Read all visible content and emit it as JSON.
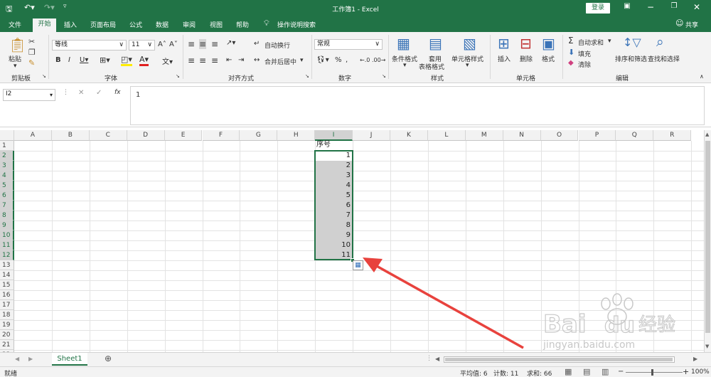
{
  "window": {
    "title": "工作簿1  -  Excel",
    "login": "登录",
    "share": "共享"
  },
  "tabs": [
    "文件",
    "开始",
    "插入",
    "页面布局",
    "公式",
    "数据",
    "审阅",
    "视图",
    "帮助",
    "操作说明搜索"
  ],
  "ribbon": {
    "clipboard": {
      "paste": "粘贴",
      "label": "剪贴板"
    },
    "font": {
      "name": "等线",
      "size": "11",
      "label": "字体"
    },
    "alignment": {
      "wrap": "自动换行",
      "merge": "合并后居中",
      "label": "对齐方式"
    },
    "number": {
      "format": "常规",
      "label": "数字"
    },
    "styles": {
      "conditional": "条件格式",
      "table": "套用",
      "table2": "表格格式",
      "cell": "单元格样式",
      "label": "样式"
    },
    "cells": {
      "insert": "插入",
      "delete": "删除",
      "format": "格式",
      "label": "单元格"
    },
    "editing": {
      "autosum": "自动求和",
      "fill": "填充",
      "clear": "清除",
      "sort": "排序和筛选",
      "find": "查找和选择",
      "label": "编辑"
    }
  },
  "formula_bar": {
    "name_box": "I2",
    "fx": "fx",
    "value": "1"
  },
  "grid": {
    "columns": [
      "A",
      "B",
      "C",
      "D",
      "E",
      "F",
      "G",
      "H",
      "I",
      "J",
      "K",
      "L",
      "M",
      "N",
      "O",
      "P",
      "Q",
      "R"
    ],
    "rows": [
      "1",
      "2",
      "3",
      "4",
      "5",
      "6",
      "7",
      "8",
      "9",
      "10",
      "11",
      "12",
      "13",
      "14",
      "15",
      "16",
      "17",
      "18",
      "19",
      "20",
      "21",
      "22"
    ],
    "header_cell": "序号",
    "values": [
      "1",
      "2",
      "3",
      "4",
      "5",
      "6",
      "7",
      "8",
      "9",
      "10",
      "11"
    ]
  },
  "sheets": [
    "Sheet1"
  ],
  "status": {
    "ready": "就绪",
    "average": "平均值: 6",
    "count": "计数: 11",
    "sum": "求和: 66",
    "zoom": "100%"
  },
  "watermark": {
    "brand": "Bai",
    "brand2": "du",
    "cn": "经验",
    "url": "jingyan.baidu.com"
  },
  "colors": {
    "excel_green": "#217346",
    "arrow_red": "#e8423d",
    "selection_fill": "#d0d0d0"
  }
}
